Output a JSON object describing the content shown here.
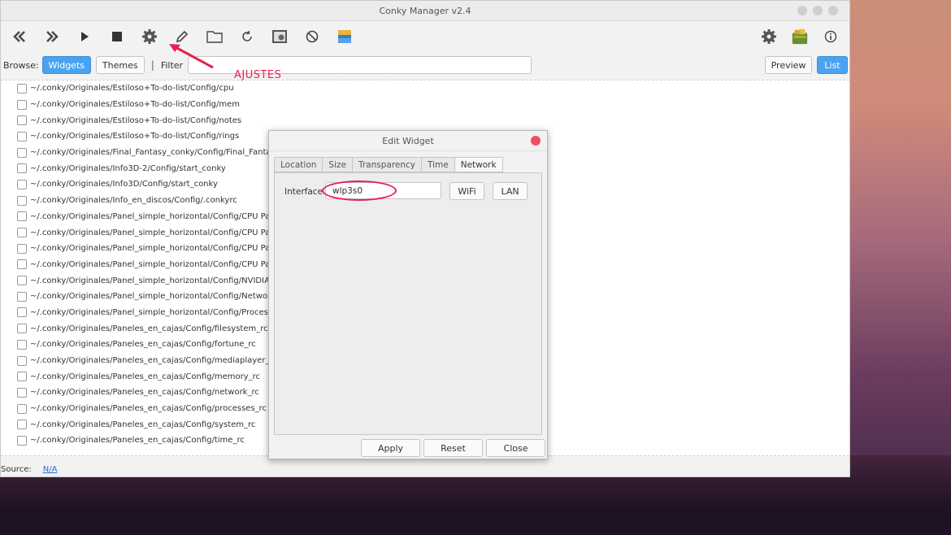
{
  "window": {
    "title": "Conky Manager v2.4"
  },
  "toolbar": {
    "left_icons": [
      "rewind-icon",
      "forward-icon",
      "play-icon",
      "stop-icon",
      "gear-icon",
      "pencil-icon",
      "folder-icon",
      "refresh-icon",
      "screenshot-icon",
      "block-icon",
      "image-icon"
    ],
    "right_icons": [
      "settings-gear-icon",
      "donate-icon",
      "info-icon"
    ]
  },
  "browse": {
    "label": "Browse:",
    "widgets_label": "Widgets",
    "themes_label": "Themes",
    "separator": "|",
    "filter_label": "Filter",
    "filter_value": "",
    "preview_label": "Preview",
    "list_label": "List"
  },
  "annotation": {
    "text": "AJUSTES",
    "color": "#e8204f"
  },
  "list": {
    "items": [
      "~/.conky/Originales/Estiloso+To-do-list/Config/cpu",
      "~/.conky/Originales/Estiloso+To-do-list/Config/mem",
      "~/.conky/Originales/Estiloso+To-do-list/Config/notes",
      "~/.conky/Originales/Estiloso+To-do-list/Config/rings",
      "~/.conky/Originales/Final_Fantasy_conky/Config/Final_Fantasy",
      "~/.conky/Originales/Info3D-2/Config/start_conky",
      "~/.conky/Originales/Info3D/Config/start_conky",
      "~/.conky/Originales/Info_en_discos/Config/.conkyrc",
      "~/.conky/Originales/Panel_simple_horizontal/Config/CPU Pane",
      "~/.conky/Originales/Panel_simple_horizontal/Config/CPU Pane",
      "~/.conky/Originales/Panel_simple_horizontal/Config/CPU Pane",
      "~/.conky/Originales/Panel_simple_horizontal/Config/CPU Pane",
      "~/.conky/Originales/Panel_simple_horizontal/Config/NVIDIA Pa",
      "~/.conky/Originales/Panel_simple_horizontal/Config/Network P",
      "~/.conky/Originales/Panel_simple_horizontal/Config/Process P",
      "~/.conky/Originales/Paneles_en_cajas/Config/filesystem_rc",
      "~/.conky/Originales/Paneles_en_cajas/Config/fortune_rc",
      "~/.conky/Originales/Paneles_en_cajas/Config/mediaplayer_rc",
      "~/.conky/Originales/Paneles_en_cajas/Config/memory_rc",
      "~/.conky/Originales/Paneles_en_cajas/Config/network_rc",
      "~/.conky/Originales/Paneles_en_cajas/Config/processes_rc",
      "~/.conky/Originales/Paneles_en_cajas/Config/system_rc",
      "~/.conky/Originales/Paneles_en_cajas/Config/time_rc"
    ]
  },
  "status": {
    "label": "Source:",
    "value": "N/A"
  },
  "dialog": {
    "title": "Edit Widget",
    "tabs": [
      "Location",
      "Size",
      "Transparency",
      "Time",
      "Network"
    ],
    "active_tab": "Network",
    "interface_label": "Interface",
    "interface_value": "wlp3s0",
    "wifi_label": "WiFi",
    "lan_label": "LAN",
    "apply_label": "Apply",
    "reset_label": "Reset",
    "close_label": "Close"
  }
}
